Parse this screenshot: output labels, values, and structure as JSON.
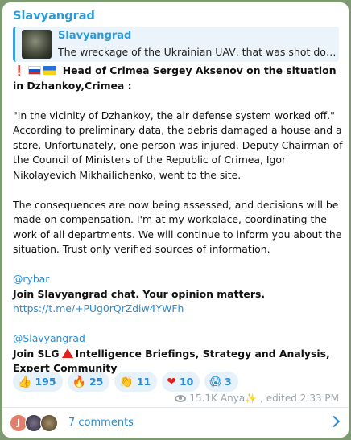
{
  "channel": {
    "name": "Slavyangrad"
  },
  "reply": {
    "title": "Slavyangrad",
    "text": "The wreckage of the Ukrainian UAV, that was shot down i..."
  },
  "post": {
    "headline": "Head of Crimea Sergey Aksenov on the situation in Dzhankoy,Crimea :",
    "para1": "\"In the vicinity of Dzhankoy, the air defense system worked off.\" According to preliminary data, the debris damaged a house and a store. Unfortunately, one person was injured. Deputy Chairman of the Council of Ministers of the Republic of Crimea, Igor Nikolayevich Mikhailichenko, went to the site.",
    "para2": "The consequences are now being assessed, and decisions will be made on compensation. I'm at my workplace, coordinating the work of all departments. We will continue to inform you about the situation. Trust only verified sources of information.",
    "mention1": "@rybar",
    "join1": "Join Slavyangrad chat. Your opinion matters.",
    "link1": "https://t.me/+PUg0rQrZdiw4YWFh",
    "mention2": "@Slavyangrad",
    "join2_a": "Join SLG",
    "join2_b": "Intelligence Briefings, Strategy and Analysis, Expert Community"
  },
  "reactions": [
    {
      "emoji": "👍",
      "count": "195"
    },
    {
      "emoji": "🔥",
      "count": "25"
    },
    {
      "emoji": "👏",
      "count": "11"
    },
    {
      "emoji": "❤",
      "count": "10"
    },
    {
      "emoji": "😱",
      "count": "3"
    }
  ],
  "meta": {
    "views": "15.1K",
    "author": "Anya",
    "author_suffix": "✨",
    "edited": ", edited 2:33 PM"
  },
  "comments": {
    "avatar_initial": "J",
    "label": "7 comments"
  },
  "colors": {
    "accent": "#2b9ad6",
    "background": "#7d9a73"
  }
}
